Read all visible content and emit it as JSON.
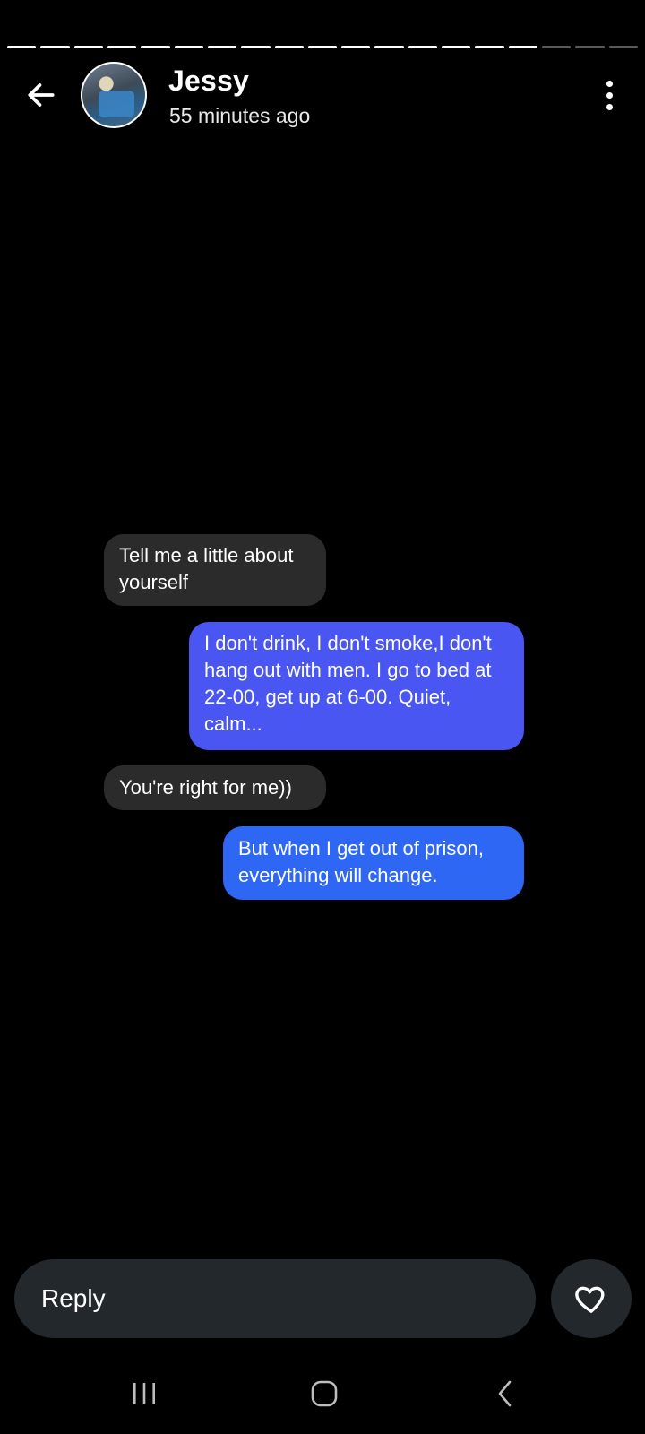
{
  "story": {
    "segments_total": 19,
    "segments_viewed": 16
  },
  "header": {
    "name": "Jessy",
    "time": "55 minutes ago",
    "back_icon": "arrow-left-icon",
    "more_icon": "more-vertical-icon"
  },
  "messages": [
    {
      "side": "received",
      "text": "Tell me a little about yourself"
    },
    {
      "side": "sent",
      "text": "I don't drink, I don't smoke,I don't hang out with men. I go to bed at 22-00, get up at 6-00. Quiet, calm..."
    },
    {
      "side": "received",
      "text": "You're right for me))"
    },
    {
      "side": "sent",
      "text": "But when I get out of prison, everything will change."
    }
  ],
  "reply": {
    "placeholder": "Reply",
    "like_icon": "heart-icon"
  },
  "navbar": {
    "recent_icon": "recent-apps-icon",
    "home_icon": "home-icon",
    "back_icon": "back-icon"
  },
  "colors": {
    "background": "#000000",
    "received_bubble": "#2b2b2b",
    "sent_bubble_1": "#4a56f2",
    "sent_bubble_2": "#2d67f3",
    "reply_bar": "#23282c"
  }
}
